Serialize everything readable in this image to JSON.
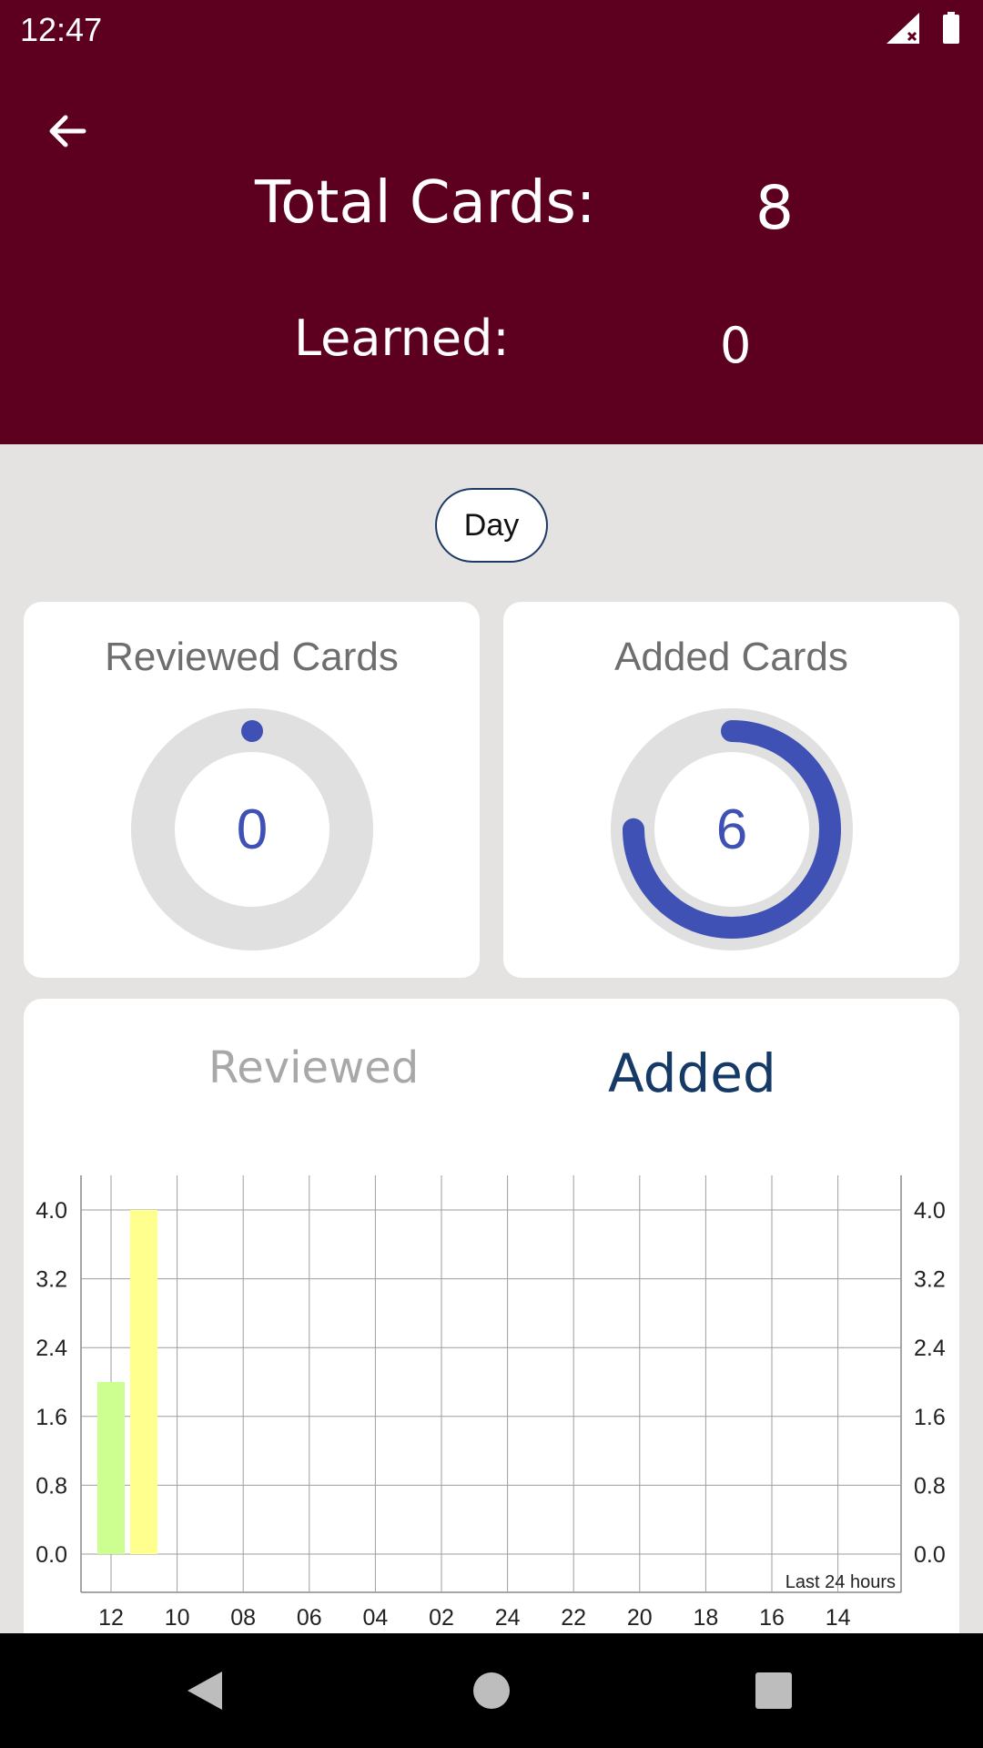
{
  "status_bar": {
    "time": "12:47"
  },
  "header": {
    "total_label": "Total Cards:",
    "total_value": "8",
    "learned_label": "Learned:",
    "learned_value": "0"
  },
  "period_button": "Day",
  "cards": {
    "reviewed": {
      "title": "Reviewed Cards",
      "value": "0",
      "progress": 0
    },
    "added": {
      "title": "Added Cards",
      "value": "6",
      "progress": 0.75
    }
  },
  "tabs": {
    "reviewed": "Reviewed",
    "added": "Added"
  },
  "colors": {
    "header": "#5d0020",
    "accent": "#3f51b5",
    "bar_green": "#ccff90",
    "bar_yellow": "#ffff8d"
  },
  "chart_data": {
    "type": "bar",
    "title": "",
    "xlabel": "",
    "ylabel": "",
    "annotation": "Last 24 hours",
    "categories": [
      "12",
      "10",
      "08",
      "06",
      "04",
      "02",
      "24",
      "22",
      "20",
      "18",
      "16",
      "14"
    ],
    "y_ticks": [
      "4.0",
      "3.2",
      "2.4",
      "1.6",
      "0.8",
      "0.0"
    ],
    "ylim": [
      0,
      4.0
    ],
    "grid": true,
    "bars": [
      {
        "hour_offset": 0,
        "value": 2,
        "color": "#ccff90"
      },
      {
        "hour_offset": 1,
        "value": 4,
        "color": "#ffff8d"
      }
    ]
  }
}
